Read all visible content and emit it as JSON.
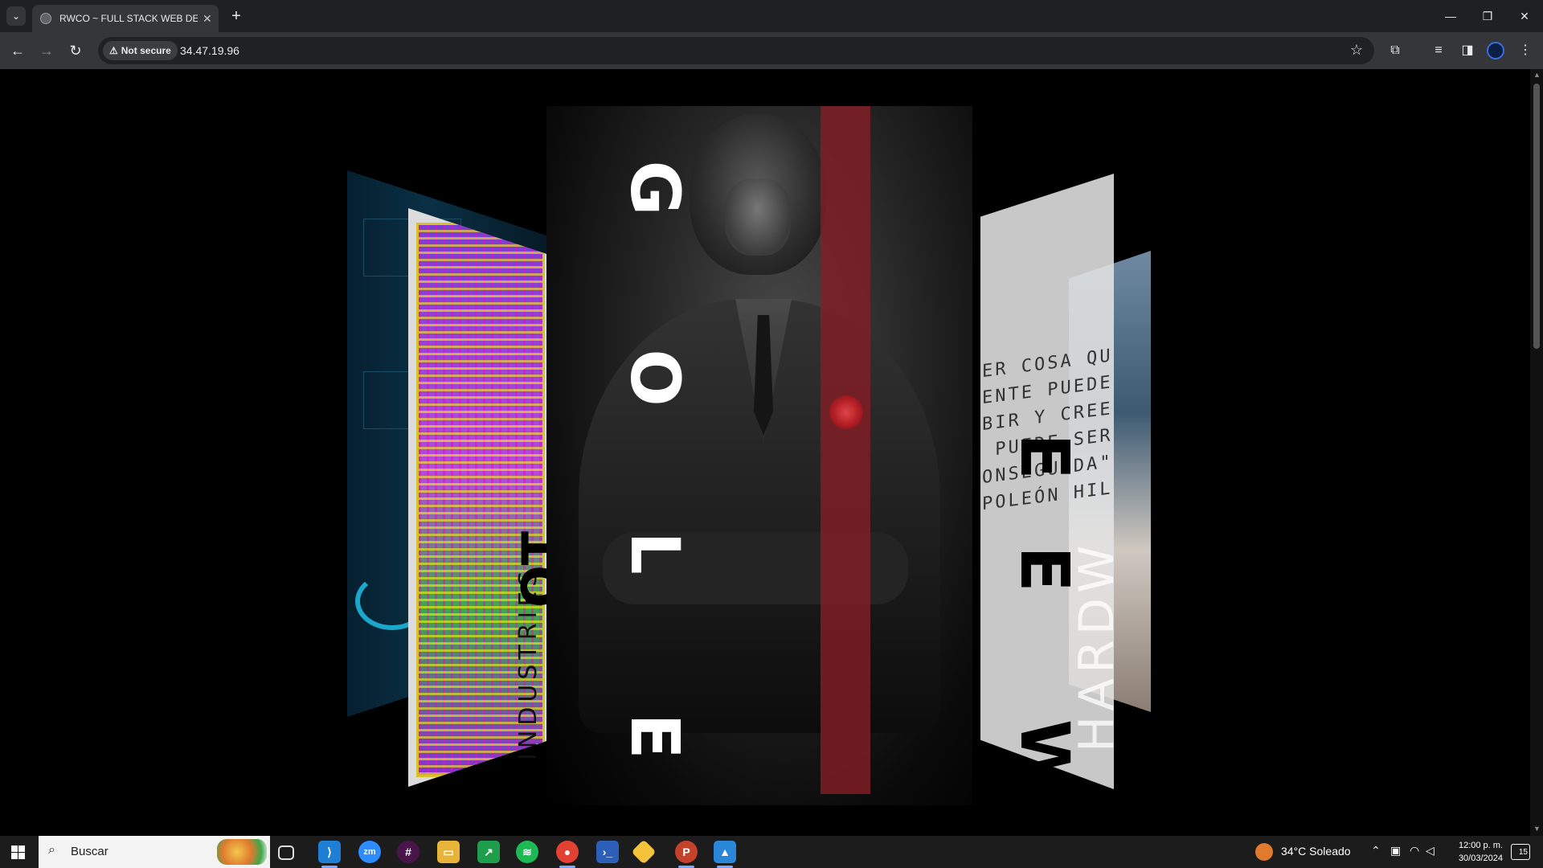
{
  "browser": {
    "tab_title": "RWCO ~ FULL STACK WEB DEV",
    "new_tab": "+",
    "tab_close": "✕",
    "security_label": "Not secure",
    "url": "34.47.19.96",
    "window_controls": {
      "minimize": "—",
      "restore": "❐",
      "close": "✕"
    }
  },
  "page": {
    "center_word_letters": [
      "G",
      "O",
      "L",
      "E"
    ],
    "right_word_letters": [
      "E",
      "E",
      "W"
    ],
    "left_vertical_text": "INDUSTRIES",
    "left_vertical_big": "OT",
    "quote_lines": [
      "ER COSA QUE",
      "ENTE PUEDE",
      "BIR Y CREER",
      " PUEDE SER",
      "ONSEGUIDA\".",
      "POLEÓN HILL"
    ],
    "right_vertical_text": "HARDW"
  },
  "taskbar": {
    "search_placeholder": "Buscar",
    "weather": "34°C  Soleado",
    "time": "12:00 p. m.",
    "date": "30/03/2024",
    "notifications": "15"
  },
  "icons": {
    "tab_search": "chevron-down-icon",
    "back": "arrow-left-icon",
    "forward": "arrow-right-icon",
    "reload": "reload-icon",
    "warning": "warning-icon",
    "bookmark": "star-icon",
    "extensions": "puzzle-icon"
  }
}
